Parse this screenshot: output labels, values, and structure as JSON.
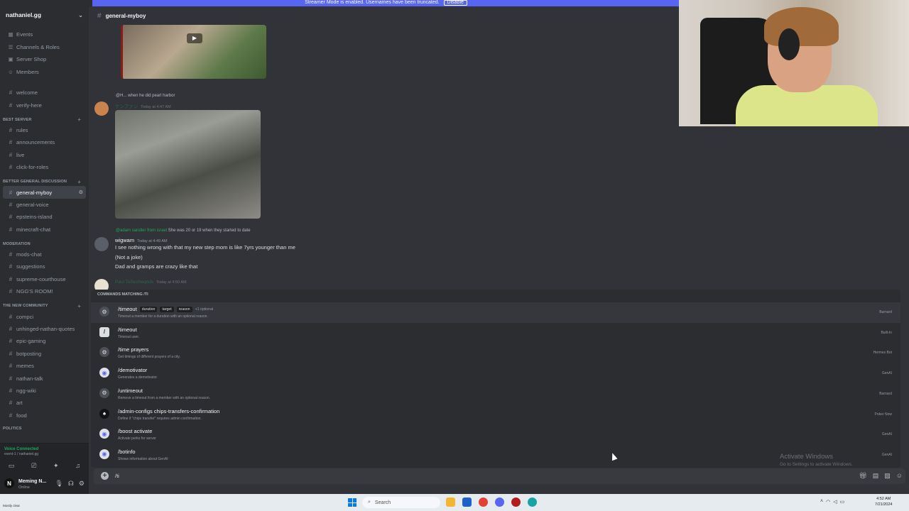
{
  "streamer_bar": {
    "text": "Streamer Mode is enabled. Usernames have been truncated.",
    "button": "Disable"
  },
  "server": {
    "name": "nathaniel.gg"
  },
  "nav_items": [
    {
      "label": "Events",
      "icon": "calendar-icon"
    },
    {
      "label": "Channels & Roles",
      "icon": "list-icon"
    },
    {
      "label": "Server Shop",
      "icon": "shop-icon"
    },
    {
      "label": "Members",
      "icon": "members-icon"
    }
  ],
  "top_channels": [
    "welcome",
    "verify-here"
  ],
  "categories": [
    {
      "name": "BEST SERVER",
      "channels": [
        "rules",
        "announcements",
        "live",
        "click-for-roles"
      ]
    },
    {
      "name": "BETTER GENERAL DISCUSSION",
      "channels": [
        "general-myboy",
        "general-voice",
        "epsteins-island",
        "minecraft-chat"
      ]
    },
    {
      "name": "MODERATION",
      "channels": [
        "mods-chat",
        "suggestions",
        "supreme-courthouse",
        "NGG'S ROOM!"
      ]
    },
    {
      "name": "THE NEW COMMUNITY",
      "channels": [
        "compci",
        "unhinged-nathan-quotes",
        "epic-gaming",
        "botposting",
        "memes",
        "nathan-talk",
        "ngg-wiki",
        "art",
        "food"
      ]
    },
    {
      "name": "POLITICS",
      "channels": []
    }
  ],
  "active_channel": "general-myboy",
  "voice": {
    "status": "Voice Connected",
    "sub": "event-1 / nathaniel.gg"
  },
  "user": {
    "initial": "N",
    "name": "Meming N...",
    "status": "Online"
  },
  "channel_header": {
    "name": "general-myboy"
  },
  "messages": [
    {
      "reply": "@H... when he did pearl harbor",
      "author": "ケンファン",
      "timestamp": "Today at 4:47 AM"
    },
    {
      "reply_mention": "@adam sandler from israel",
      "reply": "She was 20 or 19 when they started to date",
      "author": "wigwam",
      "timestamp": "Today at 4:49 AM",
      "lines": [
        "I see nothing wrong with that my new step mom is like 7yrs younger than me",
        "(Not a joke)",
        "Dad and gramps are crazy like that"
      ]
    },
    {
      "author": "Paul TeSecheqnds",
      "timestamp": "Today at 4:50 AM"
    }
  ],
  "commands": {
    "header": "COMMANDS MATCHING /TI",
    "items": [
      {
        "name": "/timeout",
        "options": [
          "duration",
          "target",
          "reason"
        ],
        "more": "+1 optional",
        "desc": "Timeout a member for a duration with an optional reason.",
        "source": "Barnard",
        "icon": "bot-icon"
      },
      {
        "name": "/timeout",
        "options": [],
        "more": "",
        "desc": "Timeout user.",
        "source": "Built-In",
        "icon": "slash-icon"
      },
      {
        "name": "/time prayers",
        "options": [],
        "more": "",
        "desc": "Get timings of different prayers of a city.",
        "source": "Hermes Bot",
        "icon": "bot-icon"
      },
      {
        "name": "/demotivator",
        "options": [],
        "more": "",
        "desc": "Generates a demotivator",
        "source": "GenAI",
        "icon": "genai-icon"
      },
      {
        "name": "/untimeout",
        "options": [],
        "more": "",
        "desc": "Remove a timeout from a member with an optional reason.",
        "source": "Barnard",
        "icon": "bot-icon"
      },
      {
        "name": "/admin-configs chips-transfers-confirmation",
        "options": [],
        "more": "",
        "desc": "Define if \"chips transfer\" requires admin confirmation.",
        "source": "Poker Now",
        "icon": "poker-icon"
      },
      {
        "name": "/boost activate",
        "options": [],
        "more": "",
        "desc": "Activate perks for server",
        "source": "GenAI",
        "icon": "genai-icon"
      },
      {
        "name": "/botinfo",
        "options": [],
        "more": "",
        "desc": "Shows information about GenAI",
        "source": "GenAI",
        "icon": "genai-icon"
      }
    ]
  },
  "input": {
    "value": "/ti"
  },
  "watermark": {
    "title": "Activate Windows",
    "sub": "Go to Settings to activate Windows."
  },
  "taskbar": {
    "weather": "Mostly clear",
    "search": "Search",
    "time": "4:52 AM",
    "date": "7/21/2024"
  }
}
